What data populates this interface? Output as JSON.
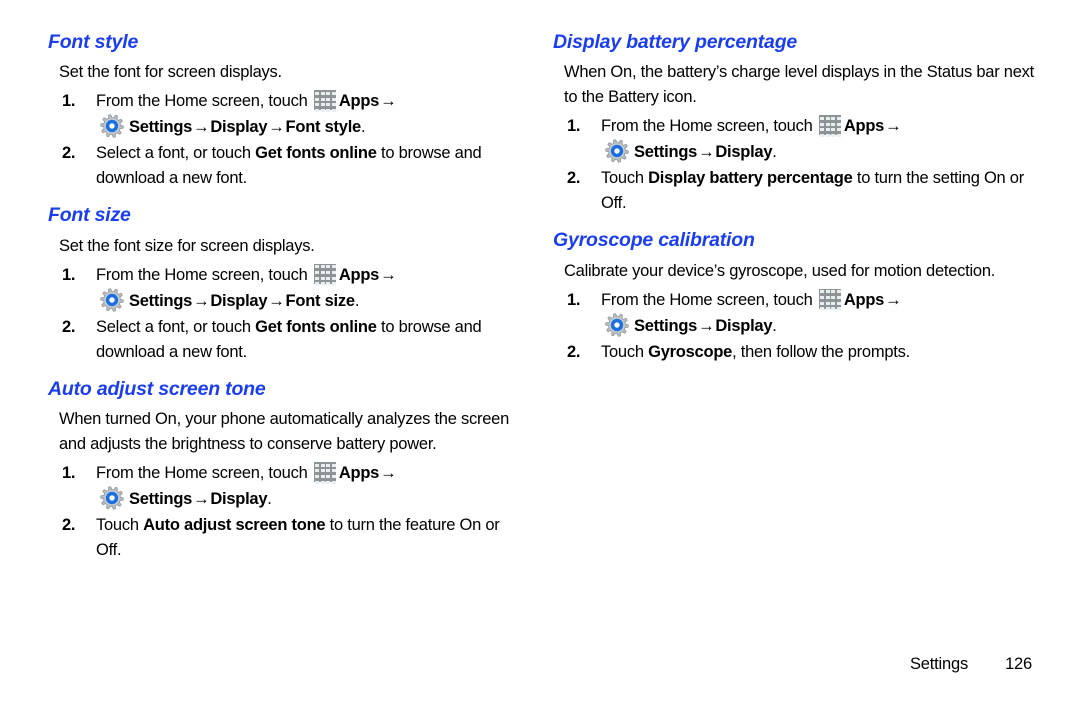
{
  "document": {
    "footer": {
      "chapter_label": "Settings",
      "page_number": "126"
    },
    "icons": {
      "apps": "apps-grid-icon",
      "settings": "settings-gear-icon"
    }
  },
  "left_column": {
    "sections": [
      {
        "heading": "Font style",
        "intro": "Set the font for screen displays.",
        "steps": [
          {
            "num": "1.",
            "line1_pre": "From the Home screen, touch",
            "line1_apps": "Apps",
            "line1_arrow": "→",
            "line2_settings": "Settings",
            "line2_arrow1": "→",
            "line2_display": "Display",
            "line2_arrow2": "→",
            "line2_target": "Font style",
            "line2_period": "."
          },
          {
            "num": "2.",
            "text_pre": "Select a font, or touch ",
            "text_bold": "Get fonts online",
            "text_post": " to browse and download a new font."
          }
        ]
      },
      {
        "heading": "Font size",
        "intro": "Set the font size for screen displays.",
        "steps": [
          {
            "num": "1.",
            "line1_pre": "From the Home screen, touch",
            "line1_apps": "Apps",
            "line1_arrow": "→",
            "line2_settings": "Settings",
            "line2_arrow1": "→",
            "line2_display": "Display",
            "line2_arrow2": "→",
            "line2_target": "Font size",
            "line2_period": "."
          },
          {
            "num": "2.",
            "text_pre": "Select a font, or touch ",
            "text_bold": "Get fonts online",
            "text_post": " to browse and download a new font."
          }
        ]
      },
      {
        "heading": "Auto adjust screen tone",
        "intro": "When turned On, your phone automatically analyzes the screen and adjusts the brightness to conserve battery power.",
        "steps": [
          {
            "num": "1.",
            "line1_pre": "From the Home screen, touch",
            "line1_apps": "Apps",
            "line1_arrow": "→",
            "line2_settings": "Settings",
            "line2_arrow1": "→",
            "line2_display": "Display",
            "line2_period": "."
          },
          {
            "num": "2.",
            "text_pre": "Touch ",
            "text_bold": "Auto adjust screen tone",
            "text_post": " to turn the feature On or Off."
          }
        ]
      }
    ]
  },
  "right_column": {
    "sections": [
      {
        "heading": "Display battery percentage",
        "intro": "When On, the battery’s charge level displays in the Status bar next to the Battery icon.",
        "steps": [
          {
            "num": "1.",
            "line1_pre": "From the Home screen, touch",
            "line1_apps": "Apps",
            "line1_arrow": "→",
            "line2_settings": "Settings",
            "line2_arrow1": "→",
            "line2_display": "Display",
            "line2_period": "."
          },
          {
            "num": "2.",
            "text_pre": "Touch ",
            "text_bold": "Display battery percentage",
            "text_post": " to turn the setting On or Off."
          }
        ]
      },
      {
        "heading": "Gyroscope calibration",
        "intro": "Calibrate your device’s gyroscope, used for motion detection.",
        "steps": [
          {
            "num": "1.",
            "line1_pre": "From the Home screen, touch",
            "line1_apps": "Apps",
            "line1_arrow": "→",
            "line2_settings": "Settings",
            "line2_arrow1": "→",
            "line2_display": "Display",
            "line2_period": "."
          },
          {
            "num": "2.",
            "text_pre": "Touch ",
            "text_bold": "Gyroscope",
            "text_post": ", then follow the prompts."
          }
        ]
      }
    ]
  },
  "colors": {
    "heading_blue": "#1a3df0",
    "body_black": "#000000",
    "gear_blue": "#1b6fe0",
    "icon_gray": "#8e9496"
  }
}
